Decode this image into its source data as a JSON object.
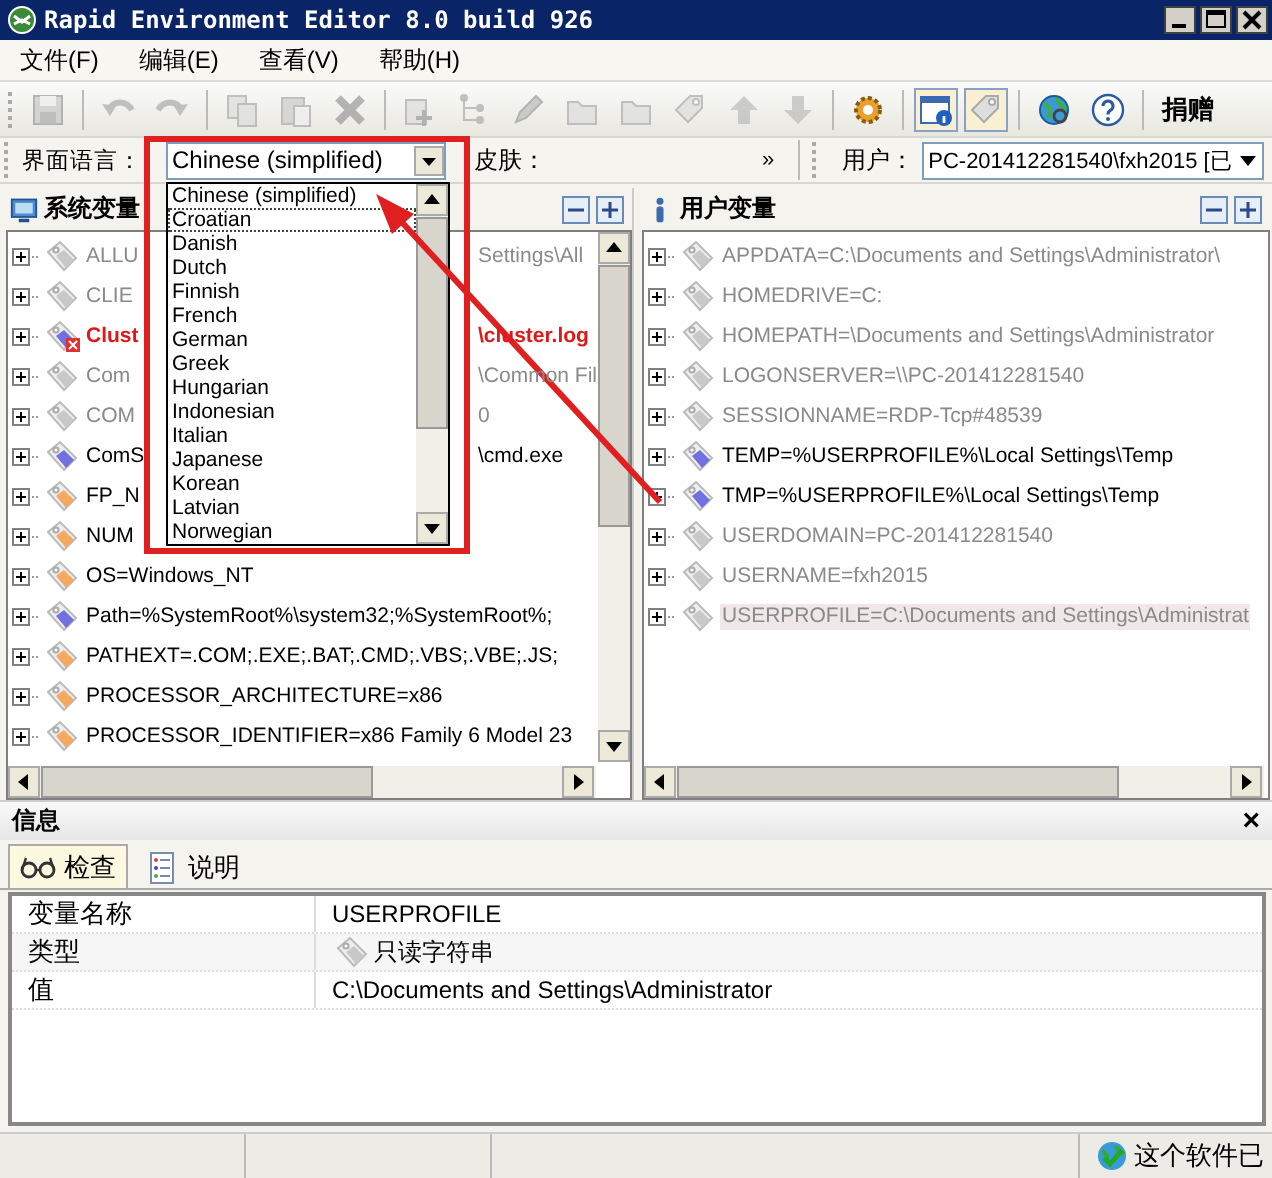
{
  "window": {
    "title": "Rapid Environment Editor 8.0 build 926"
  },
  "menu": [
    {
      "label": "文件(F)"
    },
    {
      "label": "编辑(E)"
    },
    {
      "label": "查看(V)"
    },
    {
      "label": "帮助(H)"
    }
  ],
  "toolbar": [
    {
      "kind": "save",
      "disabled": true
    },
    {
      "kind": "sep"
    },
    {
      "kind": "undo",
      "disabled": true
    },
    {
      "kind": "redo",
      "disabled": true
    },
    {
      "kind": "sep"
    },
    {
      "kind": "copy",
      "disabled": true
    },
    {
      "kind": "paste",
      "disabled": true
    },
    {
      "kind": "delete",
      "disabled": true
    },
    {
      "kind": "sep"
    },
    {
      "kind": "addvar",
      "disabled": true
    },
    {
      "kind": "addsub",
      "disabled": true
    },
    {
      "kind": "edit",
      "disabled": true
    },
    {
      "kind": "folder",
      "disabled": true
    },
    {
      "kind": "folder",
      "disabled": true
    },
    {
      "kind": "tag",
      "disabled": true
    },
    {
      "kind": "up",
      "disabled": true
    },
    {
      "kind": "down",
      "disabled": true
    },
    {
      "kind": "sep"
    },
    {
      "kind": "settings",
      "disabled": false
    },
    {
      "kind": "sep"
    },
    {
      "kind": "info",
      "disabled": false,
      "pressed": true
    },
    {
      "kind": "tag",
      "disabled": false,
      "pressed": true
    },
    {
      "kind": "sep"
    },
    {
      "kind": "globe",
      "disabled": false
    },
    {
      "kind": "help",
      "disabled": false
    },
    {
      "kind": "sep"
    },
    {
      "kind": "donate",
      "label": "捐赠"
    }
  ],
  "language_bar": {
    "label": "界面语言：",
    "value": "Chinese (simplified)",
    "skin_label": "皮肤：",
    "more": "»",
    "user_label": "用户：",
    "user_value": "PC-201412281540\\fxh2015 [已"
  },
  "language_dropdown": {
    "items": [
      {
        "label": "Chinese (simplified)",
        "focused": false
      },
      {
        "label": "Croatian",
        "focused": true
      },
      {
        "label": "Danish",
        "focused": false
      },
      {
        "label": "Dutch",
        "focused": false
      },
      {
        "label": "Finnish",
        "focused": false
      },
      {
        "label": "French",
        "focused": false
      },
      {
        "label": "German",
        "focused": false
      },
      {
        "label": "Greek",
        "focused": false
      },
      {
        "label": "Hungarian",
        "focused": false
      },
      {
        "label": "Indonesian",
        "focused": false
      },
      {
        "label": "Italian",
        "focused": false
      },
      {
        "label": "Japanese",
        "focused": false
      },
      {
        "label": "Korean",
        "focused": false
      },
      {
        "label": "Latvian",
        "focused": false
      },
      {
        "label": "Norwegian",
        "focused": false
      }
    ]
  },
  "system_variables": {
    "title": "系统变量",
    "rows": [
      {
        "kind": "readonly",
        "text": "ALLU",
        "tail": "Settings\\All",
        "selected": false
      },
      {
        "kind": "readonly",
        "text": "CLIE",
        "selected": false
      },
      {
        "kind": "error",
        "text": "Clust",
        "tail": "\\cluster.log",
        "selected": false
      },
      {
        "kind": "readonly",
        "text": "Com",
        "tail": "\\Common Fil",
        "selected": false
      },
      {
        "kind": "readonly",
        "text": "COM",
        "tail": "0",
        "selected": false
      },
      {
        "kind": "user",
        "text": "ComS",
        "tail": "\\cmd.exe",
        "selected": false
      },
      {
        "kind": "system",
        "text": "FP_N",
        "selected": false
      },
      {
        "kind": "system",
        "text": "NUM",
        "selected": false
      },
      {
        "kind": "system",
        "text": "OS=Windows_NT",
        "selected": false
      },
      {
        "kind": "user",
        "text": "Path=%SystemRoot%\\system32;%SystemRoot%;",
        "selected": false
      },
      {
        "kind": "system",
        "text": "PATHEXT=.COM;.EXE;.BAT;.CMD;.VBS;.VBE;.JS;",
        "selected": false
      },
      {
        "kind": "system",
        "text": "PROCESSOR_ARCHITECTURE=x86",
        "selected": false
      },
      {
        "kind": "system",
        "text": "PROCESSOR_IDENTIFIER=x86 Family 6 Model 23",
        "selected": false
      }
    ]
  },
  "user_variables": {
    "title": "用户变量",
    "rows": [
      {
        "kind": "readonly",
        "text": "APPDATA=C:\\Documents and Settings\\Administrator\\",
        "selected": false
      },
      {
        "kind": "readonly",
        "text": "HOMEDRIVE=C:",
        "selected": false
      },
      {
        "kind": "readonly",
        "text": "HOMEPATH=\\Documents and Settings\\Administrator",
        "selected": false
      },
      {
        "kind": "readonly",
        "text": "LOGONSERVER=\\\\PC-201412281540",
        "selected": false
      },
      {
        "kind": "readonly",
        "text": "SESSIONNAME=RDP-Tcp#48539",
        "selected": false
      },
      {
        "kind": "user",
        "text": "TEMP=%USERPROFILE%\\Local Settings\\Temp",
        "selected": false
      },
      {
        "kind": "user",
        "text": "TMP=%USERPROFILE%\\Local Settings\\Temp",
        "selected": false
      },
      {
        "kind": "readonly",
        "text": "USERDOMAIN=PC-201412281540",
        "selected": false
      },
      {
        "kind": "readonly",
        "text": "USERNAME=fxh2015",
        "selected": false
      },
      {
        "kind": "readonly",
        "text": "USERPROFILE=C:\\Documents and Settings\\Administrat",
        "selected": true
      }
    ]
  },
  "info": {
    "title": "信息",
    "close": "×",
    "tabs": [
      {
        "label": "检查",
        "kind": "inspect",
        "selected": true
      },
      {
        "label": "说明",
        "kind": "notes",
        "selected": false
      }
    ],
    "rows": [
      {
        "name": "变量名称",
        "value": "USERPROFILE",
        "kind": "text"
      },
      {
        "name": "类型",
        "value": "只读字符串",
        "kind": "type"
      },
      {
        "name": "值",
        "value": "C:\\Documents and Settings\\Administrator",
        "kind": "text"
      }
    ]
  },
  "status_bar": {
    "message": "这个软件已"
  }
}
